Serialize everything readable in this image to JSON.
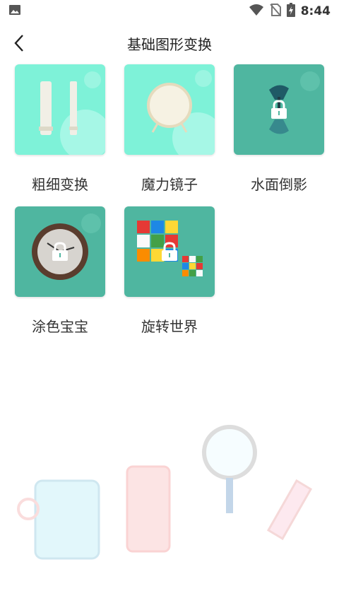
{
  "status": {
    "time": "8:44"
  },
  "header": {
    "title": "基础图形变换"
  },
  "items": [
    {
      "label": "粗细变换",
      "locked": false
    },
    {
      "label": "魔力镜子",
      "locked": false
    },
    {
      "label": "水面倒影",
      "locked": true
    },
    {
      "label": "涂色宝宝",
      "locked": true
    },
    {
      "label": "旋转世界",
      "locked": true
    }
  ],
  "colors": {
    "unlocked_bg": "#7ef2d8",
    "locked_bg": "#4fb6a0",
    "accent": "#3aa98e"
  }
}
